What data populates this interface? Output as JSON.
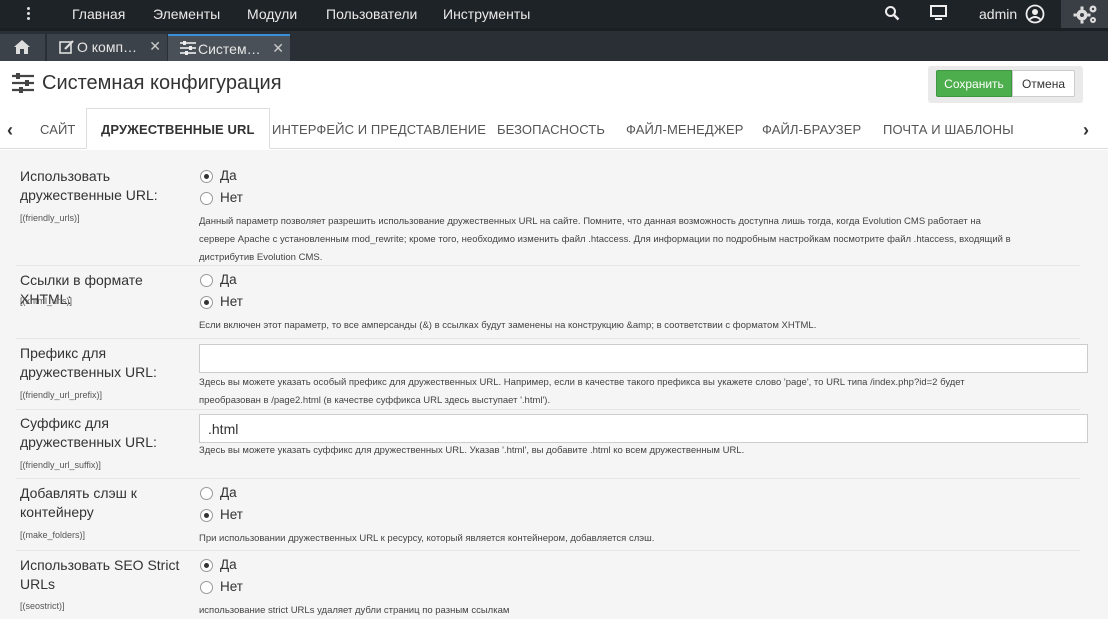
{
  "topnav": {
    "menu": [
      "Главная",
      "Элементы",
      "Модули",
      "Пользователи",
      "Инструменты"
    ],
    "user": "admin"
  },
  "tabs": [
    {
      "label": "О комп…"
    },
    {
      "label": "Систем…"
    }
  ],
  "header": {
    "title": "Системная конфигурация",
    "save_label": "Сохранить",
    "cancel_label": "Отмена"
  },
  "settings_tabs": [
    "САЙТ",
    "ДРУЖЕСТВЕННЫЕ URL",
    "ИНТЕРФЕЙС И ПРЕДСТАВЛЕНИЕ",
    "БЕЗОПАСНОСТЬ",
    "ФАЙЛ-МЕНЕДЖЕР",
    "ФАЙЛ-БРАУЗЕР",
    "ПОЧТА И ШАБЛОНЫ"
  ],
  "fields": [
    {
      "label_lines": [
        "Использовать",
        "дружественные URL:"
      ],
      "key": "[(friendly_urls)]",
      "options": [
        "Да",
        "Нет"
      ],
      "selected": "Да",
      "desc_lines": [
        "Данный параметр позволяет разрешить использование дружественных URL на сайте. Помните, что данная возможность доступна лишь тогда, когда Evolution CMS работает на",
        "сервере Apache с установленным mod_rewrite; кроме того, необходимо изменить файл .htaccess. Для информации по подробным настройкам посмотрите файл .htaccess, входящий в",
        "дистрибутив Evolution CMS."
      ]
    },
    {
      "label_lines": [
        "Ссылки в формате XHTML:"
      ],
      "key": "[(xhtml_urls)]",
      "options": [
        "Да",
        "Нет"
      ],
      "selected": "Нет",
      "desc_lines": [
        "Если включен этот параметр, то все амперсанды (&) в ссылках будут заменены на конструкцию &amp; в соответствии с форматом XHTML."
      ]
    },
    {
      "label_lines": [
        "Префикс для",
        "дружественных URL:"
      ],
      "key": "[(friendly_url_prefix)]",
      "value": "",
      "desc_lines": [
        "Здесь вы можете указать особый префикс для дружественных URL. Например, если в качестве такого префикса вы укажете слово 'page', то URL типа /index.php?id=2 будет",
        "преобразован в /page2.html (в качестве суффикса URL здесь выступает '.html')."
      ]
    },
    {
      "label_lines": [
        "Суффикс для",
        "дружественных URL:"
      ],
      "key": "[(friendly_url_suffix)]",
      "value": ".html",
      "desc_lines": [
        "Здесь вы можете указать суффикс для дружественных URL. Указав '.html', вы добавите .html ко всем дружественным URL."
      ]
    },
    {
      "label_lines": [
        "Добавлять слэш к",
        "контейнеру"
      ],
      "key": "[(make_folders)]",
      "options": [
        "Да",
        "Нет"
      ],
      "selected": "Нет",
      "desc_lines": [
        "При использовании дружественных URL к ресурсу, который является контейнером, добавляется слэш."
      ]
    },
    {
      "label_lines": [
        "Использовать SEO Strict",
        "URLs"
      ],
      "key": "[(seostrict)]",
      "options": [
        "Да",
        "Нет"
      ],
      "selected": "Да",
      "desc_lines": [
        "использование strict URLs удаляет дубли страниц по разным ссылкам"
      ]
    }
  ]
}
